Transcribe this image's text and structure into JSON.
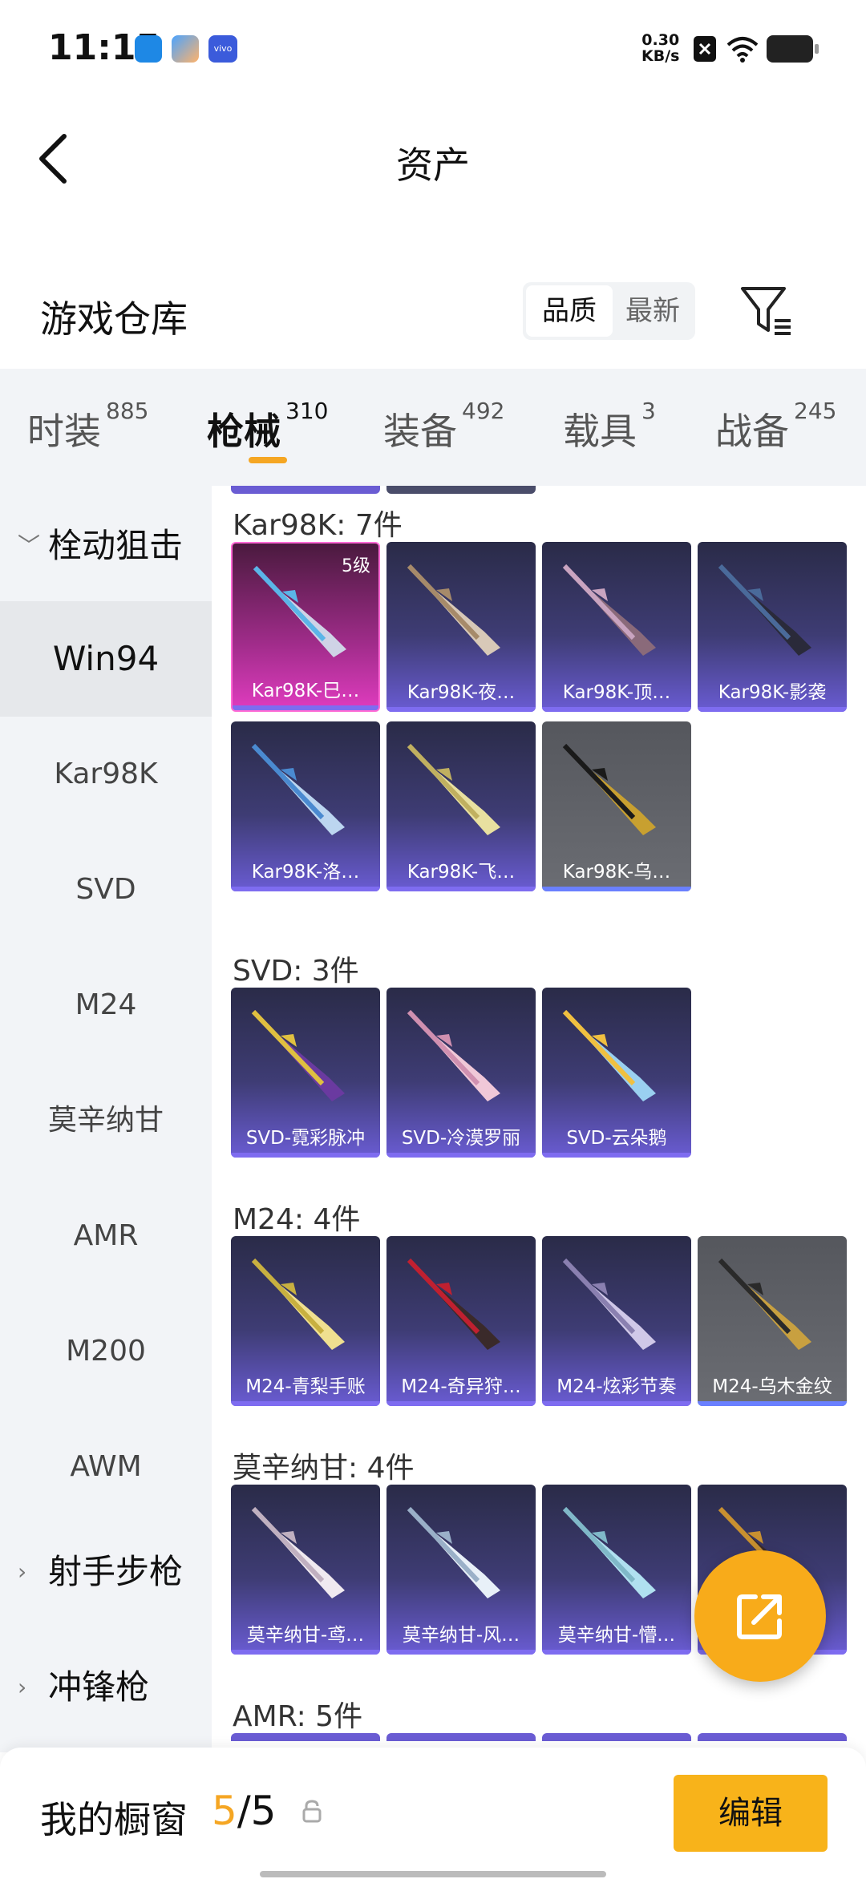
{
  "status_bar": {
    "time": "11:15",
    "net_speed": "0.30",
    "net_unit": "KB/s",
    "app_icons": [
      "blue-app-icon",
      "gradient-app-icon",
      "vivo-app-icon"
    ],
    "vivo_text": "vivo"
  },
  "header": {
    "title": "资产"
  },
  "warehouse": {
    "title": "游戏仓库",
    "sort_quality": "品质",
    "sort_newest": "最新"
  },
  "tabs": [
    {
      "label": "时装",
      "count": "885"
    },
    {
      "label": "枪械",
      "count": "310"
    },
    {
      "label": "装备",
      "count": "492"
    },
    {
      "label": "载具",
      "count": "3"
    },
    {
      "label": "战备",
      "count": "245"
    }
  ],
  "sidebar": {
    "group_bolt": "栓动狙击",
    "items": [
      "Win94",
      "Kar98K",
      "SVD",
      "M24",
      "莫辛纳甘",
      "AMR",
      "M200",
      "AWM"
    ],
    "group_marksman": "射手步枪",
    "group_smg": "冲锋枪"
  },
  "sections": [
    {
      "title": "Kar98K: 7件",
      "items": [
        {
          "label": "Kar98K-巳…",
          "level": "5级",
          "style": "pink"
        },
        {
          "label": "Kar98K-夜…",
          "style": "purple"
        },
        {
          "label": "Kar98K-顶…",
          "style": "purple"
        },
        {
          "label": "Kar98K-影袭",
          "style": "purple"
        },
        {
          "label": "Kar98K-洛…",
          "style": "purple"
        },
        {
          "label": "Kar98K-飞…",
          "style": "purple"
        },
        {
          "label": "Kar98K-乌…",
          "style": "gray"
        }
      ]
    },
    {
      "title": "SVD: 3件",
      "items": [
        {
          "label": "SVD-霓彩脉冲",
          "style": "purple"
        },
        {
          "label": "SVD-冷漠罗丽",
          "style": "purple"
        },
        {
          "label": "SVD-云朵鹅",
          "style": "purple"
        }
      ]
    },
    {
      "title": "M24: 4件",
      "items": [
        {
          "label": "M24-青梨手账",
          "style": "purple"
        },
        {
          "label": "M24-奇异狩…",
          "style": "purple"
        },
        {
          "label": "M24-炫彩节奏",
          "style": "purple"
        },
        {
          "label": "M24-乌木金纹",
          "style": "gray"
        }
      ]
    },
    {
      "title": "莫辛纳甘: 4件",
      "items": [
        {
          "label": "莫辛纳甘-鸢…",
          "style": "purple"
        },
        {
          "label": "莫辛纳甘-风…",
          "style": "purple"
        },
        {
          "label": "莫辛纳甘-懵…",
          "style": "purple"
        },
        {
          "label": "…",
          "style": "purple"
        }
      ]
    },
    {
      "title": "AMR: 5件",
      "items": []
    }
  ],
  "bottom_bar": {
    "label": "我的橱窗",
    "current": "5",
    "separator": "/",
    "total": "5",
    "edit_label": "编辑"
  },
  "colors": {
    "accent": "#f5a623",
    "card_purple": "#6a5cd3",
    "card_pink": "#e03cbf",
    "fab": "#f8ab1a"
  }
}
